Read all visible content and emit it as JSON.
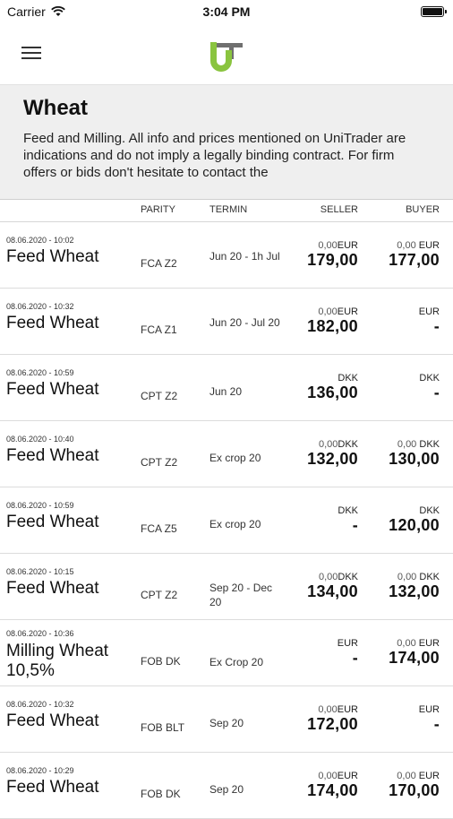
{
  "status": {
    "carrier": "Carrier",
    "time": "3:04 PM"
  },
  "colors": {
    "brand_green": "#8ac43f",
    "brand_gray": "#6f6f6f"
  },
  "header": {
    "title": "Wheat",
    "description": "Feed and Milling.  All info and prices mentioned on UniTrader are indications and do not imply a legally binding contract. For firm offers or bids don't hesitate to contact the"
  },
  "columns": {
    "parity": "PARITY",
    "termin": "TERMIN",
    "seller": "SELLER",
    "buyer": "BUYER"
  },
  "rows": [
    {
      "date": "08.06.2020 - 10:02",
      "product": "Feed Wheat",
      "parity": "FCA Z2",
      "termin": "Jun 20 - 1h Jul",
      "seller_change": "0,00",
      "seller_cur": "EUR",
      "seller_price": "179,00",
      "buyer_change": "0,00",
      "buyer_cur": "EUR",
      "buyer_price": "177,00"
    },
    {
      "date": "08.06.2020 - 10:32",
      "product": "Feed Wheat",
      "parity": "FCA Z1",
      "termin": "Jun 20 - Jul 20",
      "seller_change": "0,00",
      "seller_cur": "EUR",
      "seller_price": "182,00",
      "buyer_change": "",
      "buyer_cur": "EUR",
      "buyer_price": "-"
    },
    {
      "date": "08.06.2020 - 10:59",
      "product": "Feed Wheat",
      "parity": "CPT Z2",
      "termin": "Jun 20",
      "seller_change": "",
      "seller_cur": "DKK",
      "seller_price": "136,00",
      "buyer_change": "",
      "buyer_cur": "DKK",
      "buyer_price": "-"
    },
    {
      "date": "08.06.2020 - 10:40",
      "product": "Feed Wheat",
      "parity": "CPT Z2",
      "termin": "Ex crop 20",
      "seller_change": "0,00",
      "seller_cur": "DKK",
      "seller_price": "132,00",
      "buyer_change": "0,00",
      "buyer_cur": "DKK",
      "buyer_price": "130,00"
    },
    {
      "date": "08.06.2020 - 10:59",
      "product": "Feed Wheat",
      "parity": "FCA Z5",
      "termin": "Ex crop 20",
      "seller_change": "",
      "seller_cur": "DKK",
      "seller_price": "-",
      "buyer_change": "",
      "buyer_cur": "DKK",
      "buyer_price": "120,00"
    },
    {
      "date": "08.06.2020 - 10:15",
      "product": "Feed Wheat",
      "parity": "CPT Z2",
      "termin": "Sep 20 - Dec 20",
      "seller_change": "0,00",
      "seller_cur": "DKK",
      "seller_price": "134,00",
      "buyer_change": "0,00",
      "buyer_cur": "DKK",
      "buyer_price": "132,00"
    },
    {
      "date": "08.06.2020 - 10:36",
      "product": "Milling Wheat 10,5%",
      "parity": "FOB DK",
      "termin": "Ex Crop 20",
      "seller_change": "",
      "seller_cur": "EUR",
      "seller_price": "-",
      "buyer_change": "0,00",
      "buyer_cur": "EUR",
      "buyer_price": "174,00"
    },
    {
      "date": "08.06.2020 - 10:32",
      "product": "Feed Wheat",
      "parity": "FOB BLT",
      "termin": "Sep 20",
      "seller_change": "0,00",
      "seller_cur": "EUR",
      "seller_price": "172,00",
      "buyer_change": "",
      "buyer_cur": "EUR",
      "buyer_price": "-"
    },
    {
      "date": "08.06.2020 - 10:29",
      "product": "Feed Wheat",
      "parity": "FOB DK",
      "termin": "Sep 20",
      "seller_change": "0,00",
      "seller_cur": "EUR",
      "seller_price": "174,00",
      "buyer_change": "0,00",
      "buyer_cur": "EUR",
      "buyer_price": "170,00"
    }
  ]
}
